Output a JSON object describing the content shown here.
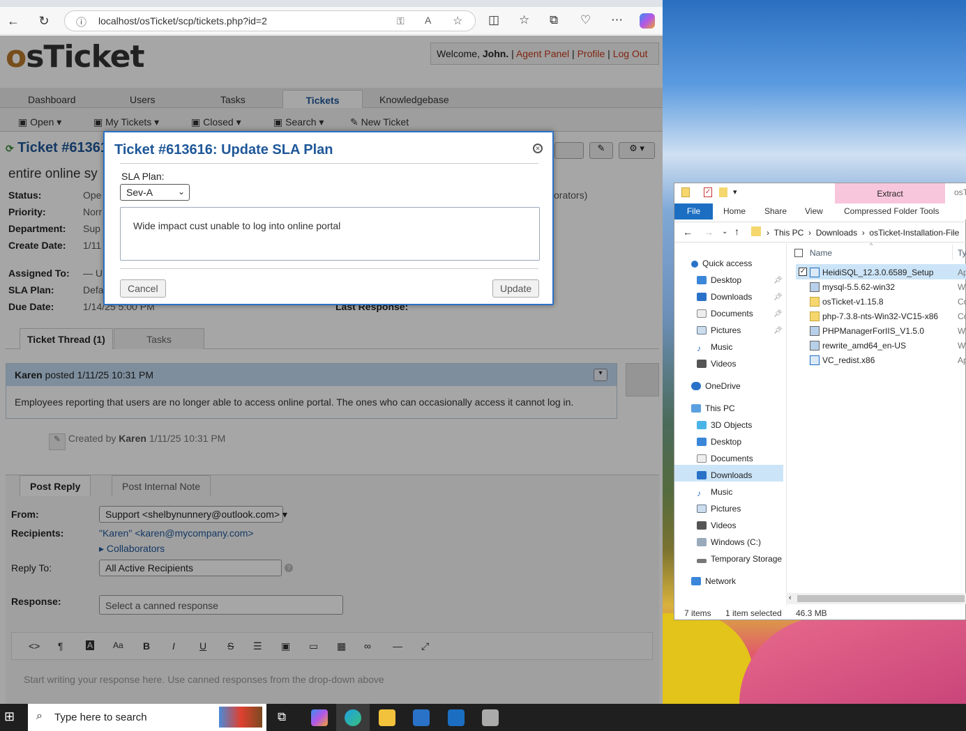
{
  "browser": {
    "url": "localhost/osTicket/scp/tickets.php?id=2"
  },
  "osticket": {
    "logo": "osTicket",
    "welcome_prefix": "Welcome, ",
    "user": "John.",
    "links": [
      "Agent Panel",
      "Profile",
      "Log Out"
    ],
    "nav_tabs": [
      "Dashboard",
      "Users",
      "Tasks",
      "Tickets",
      "Knowledgebase"
    ],
    "active_tab": "Tickets",
    "subnav": [
      "Open",
      "My Tickets",
      "Closed",
      "Search",
      "New Ticket"
    ],
    "ticket_header": "Ticket #61361",
    "subject": "entire online sy",
    "info_labels": [
      "Status:",
      "Priority:",
      "Department:",
      "Create Date:",
      "Assigned To:",
      "SLA Plan:",
      "Due Date:"
    ],
    "info_values": [
      "Ope",
      "Norr",
      "Sup",
      "1/11",
      "— U",
      "Defa",
      "1/14/25 5:00 PM"
    ],
    "collaborators_fragment": "orators)",
    "last_response_label": "Last Response:",
    "thread_tabs": [
      "Ticket Thread (1)",
      "Tasks"
    ],
    "post": {
      "author": "Karen",
      "posted": " posted 1/11/25 10:31 PM",
      "body": "Employees reporting that users are no longer able to access online portal. The ones who can occasionally access it cannot log in."
    },
    "created_by": {
      "prefix": "Created by",
      "name": "Karen",
      "time": "1/11/25 10:31 PM"
    },
    "reply_tabs": [
      "Post Reply",
      "Post Internal Note"
    ],
    "reply": {
      "from_label": "From:",
      "from_value": "Support <shelbynunnery@outlook.com>",
      "recipients_label": "Recipients:",
      "recipients_value": "\"Karen\" <karen@mycompany.com>",
      "collaborators": "Collaborators",
      "reply_to_label": "Reply To:",
      "reply_to_value": "All Active Recipients",
      "response_label": "Response:",
      "canned": "Select a canned response",
      "editor_placeholder": "Start writing your response here. Use canned responses from the drop-down above"
    },
    "toolbar_icons": [
      "code-icon",
      "paragraph-icon",
      "text-color-icon",
      "font-size-icon",
      "bold-icon",
      "italic-icon",
      "underline-icon",
      "strikethrough-icon",
      "list-icon",
      "image-icon",
      "video-icon",
      "table-icon",
      "link-icon",
      "hr-icon",
      "fullscreen-icon"
    ]
  },
  "modal": {
    "title": "Ticket #613616: Update SLA Plan",
    "sla_label": "SLA Plan:",
    "sla_value": "Sev-A",
    "comment": "Wide impact cust unable to log into online portal",
    "cancel": "Cancel",
    "update": "Update"
  },
  "explorer": {
    "extract_tab": "Extract",
    "title_fragment": "osT",
    "ribbon_tabs": [
      "File",
      "Home",
      "Share",
      "View",
      "Compressed Folder Tools"
    ],
    "breadcrumb": [
      "This PC",
      "Downloads",
      "osTicket-Installation-File"
    ],
    "column_name": "Name",
    "column_type": "Ty",
    "quick_access": "Quick access",
    "quick_items": [
      "Desktop",
      "Downloads",
      "Documents",
      "Pictures",
      "Music",
      "Videos"
    ],
    "onedrive": "OneDrive",
    "this_pc": "This PC",
    "pc_items": [
      "3D Objects",
      "Desktop",
      "Documents",
      "Downloads",
      "Music",
      "Pictures",
      "Videos",
      "Windows (C:)",
      "Temporary Storage"
    ],
    "network": "Network",
    "files": [
      "HeidiSQL_12.3.0.6589_Setup",
      "mysql-5.5.62-win32",
      "osTicket-v1.15.8",
      "php-7.3.8-nts-Win32-VC15-x86",
      "PHPManagerForIIS_V1.5.0",
      "rewrite_amd64_en-US",
      "VC_redist.x86"
    ],
    "file_types": [
      "Ap",
      "W",
      "Co",
      "Co",
      "W",
      "W",
      "Ap"
    ],
    "status_items": "7 items",
    "status_selected": "1 item selected",
    "status_size": "46.3 MB"
  },
  "taskbar": {
    "search_placeholder": "Type here to search"
  },
  "colors": {
    "accent": "#1e5799",
    "link": "#c6381a",
    "extract": "#f8c6dc",
    "file_tab": "#1b6ec2"
  }
}
